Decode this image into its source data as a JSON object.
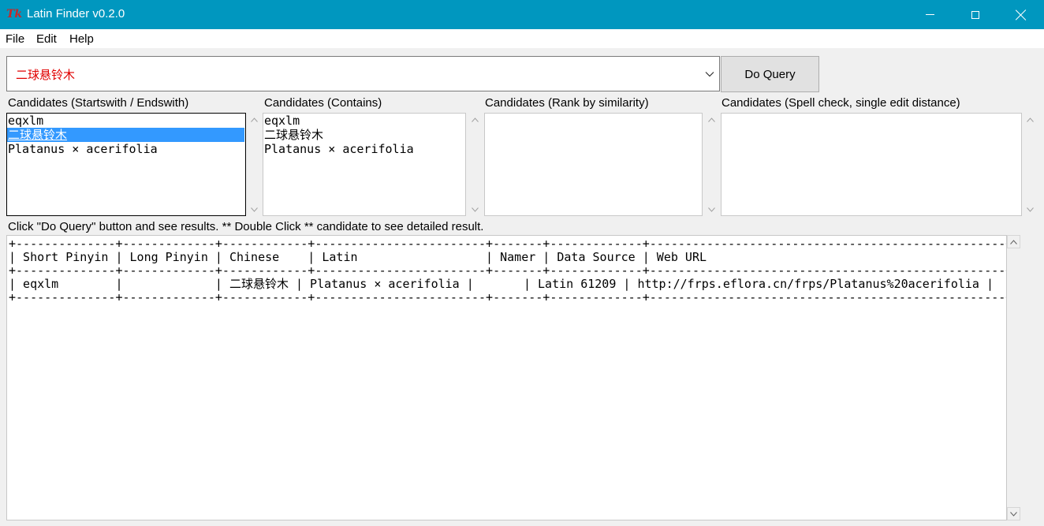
{
  "window": {
    "icon": "Tk",
    "title": "Latin Finder v0.2.0"
  },
  "menu": {
    "file": "File",
    "edit": "Edit",
    "help": "Help"
  },
  "query": {
    "value": "二球悬铃木",
    "value_color": "#e00000",
    "button_label": "Do Query"
  },
  "panels": [
    {
      "label": "Candidates (Startswith / Endswith)",
      "items": [
        "eqxlm",
        "二球悬铃木",
        "Platanus × acerifolia"
      ],
      "selected_index": 1
    },
    {
      "label": "Candidates (Contains)",
      "items": [
        "eqxlm",
        "二球悬铃木",
        "Platanus × acerifolia"
      ]
    },
    {
      "label": "Candidates (Rank by similarity)",
      "items": []
    },
    {
      "label": "Candidates (Spell check, single edit distance)",
      "items": []
    }
  ],
  "hint": "Click \"Do Query\" button and see results. ** Double Click ** candidate to see detailed result.",
  "results": {
    "lines": [
      "+--------------+-------------+------------+------------------------+-------+-------------+--------------------------------------------------+",
      "| Short Pinyin | Long Pinyin | Chinese    | Latin                  | Namer | Data Source | Web URL                                          |",
      "+--------------+-------------+------------+------------------------+-------+-------------+--------------------------------------------------+",
      "| eqxlm        |             | 二球悬铃木 | Platanus × acerifolia |       | Latin 61209 | http://frps.eflora.cn/frps/Platanus%20acerifolia |",
      "+--------------+-------------+------------+------------------------+-------+-------------+--------------------------------------------------+"
    ]
  },
  "colors": {
    "titlebar": "#0097bf",
    "selection": "#3399ff"
  },
  "icons": {
    "minimize": "minimize-icon",
    "maximize": "maximize-icon",
    "close": "close-icon",
    "dropdown": "chevron-down-icon"
  }
}
